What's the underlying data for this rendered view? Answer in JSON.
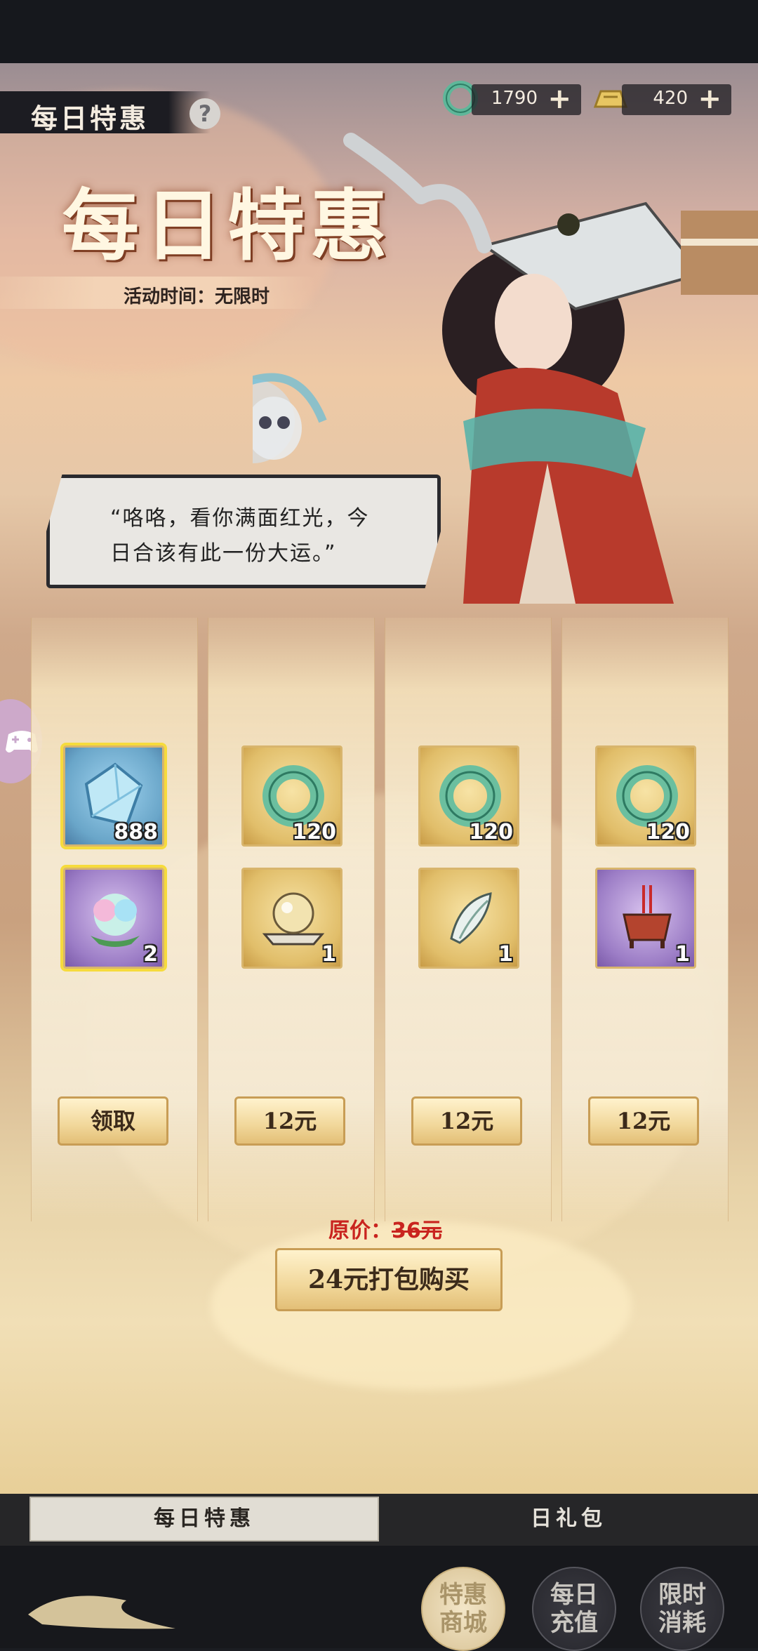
{
  "header": {
    "tag_title": "每日特惠",
    "help_symbol": "?",
    "big_title": "每日特惠",
    "activity_time": "活动时间：无限时"
  },
  "resources": [
    {
      "icon": "jade-ring-icon",
      "value": "1790",
      "plus": "+"
    },
    {
      "icon": "gold-ingot-icon",
      "value": "420",
      "plus": "+"
    }
  ],
  "speech": {
    "line1": "“咯咯，看你满面红光，今",
    "line2": "日合该有此一份大运。”"
  },
  "columns": [
    {
      "items": [
        {
          "icon": "blue-crystal-icon",
          "count": "888"
        },
        {
          "icon": "lotus-pearl-icon",
          "count": "2"
        }
      ],
      "button": "领取"
    },
    {
      "items": [
        {
          "icon": "jade-ring-icon",
          "count": "120"
        },
        {
          "icon": "crystal-orb-icon",
          "count": "1"
        }
      ],
      "button": "12元"
    },
    {
      "items": [
        {
          "icon": "jade-ring-icon",
          "count": "120"
        },
        {
          "icon": "jade-cicada-icon",
          "count": "1"
        }
      ],
      "button": "12元"
    },
    {
      "items": [
        {
          "icon": "jade-ring-icon",
          "count": "120"
        },
        {
          "icon": "incense-burner-icon",
          "count": "1"
        }
      ],
      "button": "12元"
    }
  ],
  "bundle": {
    "original_label": "原价：",
    "original_price": "36元",
    "button": "24元打包购买"
  },
  "tabs": {
    "active": "每日特惠",
    "inactive": "日礼包"
  },
  "bottom_nav": [
    {
      "line1": "特惠",
      "line2": "商城",
      "active": true
    },
    {
      "line1": "每日",
      "line2": "充值",
      "active": false
    },
    {
      "line1": "限时",
      "line2": "消耗",
      "active": false
    }
  ],
  "colors": {
    "accent_gold": "#e3bf77",
    "price_red": "#c9241f",
    "selected_border": "#f6db3c"
  }
}
